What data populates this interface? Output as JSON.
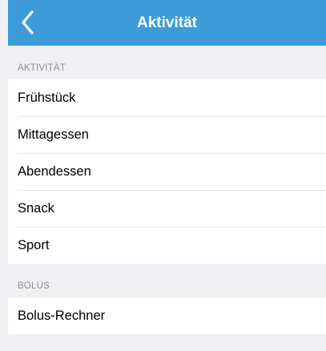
{
  "header": {
    "title": "Aktivität",
    "back_icon": "chevron-left-icon"
  },
  "sections": [
    {
      "title": "AKTIVITÄT",
      "items": [
        "Frühstück",
        "Mittagessen",
        "Abendessen",
        "Snack",
        "Sport"
      ]
    },
    {
      "title": "BOLUS",
      "items": [
        "Bolus-Rechner"
      ]
    }
  ],
  "colors": {
    "navbar": "#3d9bd7",
    "background": "#efeff4",
    "section_text": "#8e8e93"
  }
}
